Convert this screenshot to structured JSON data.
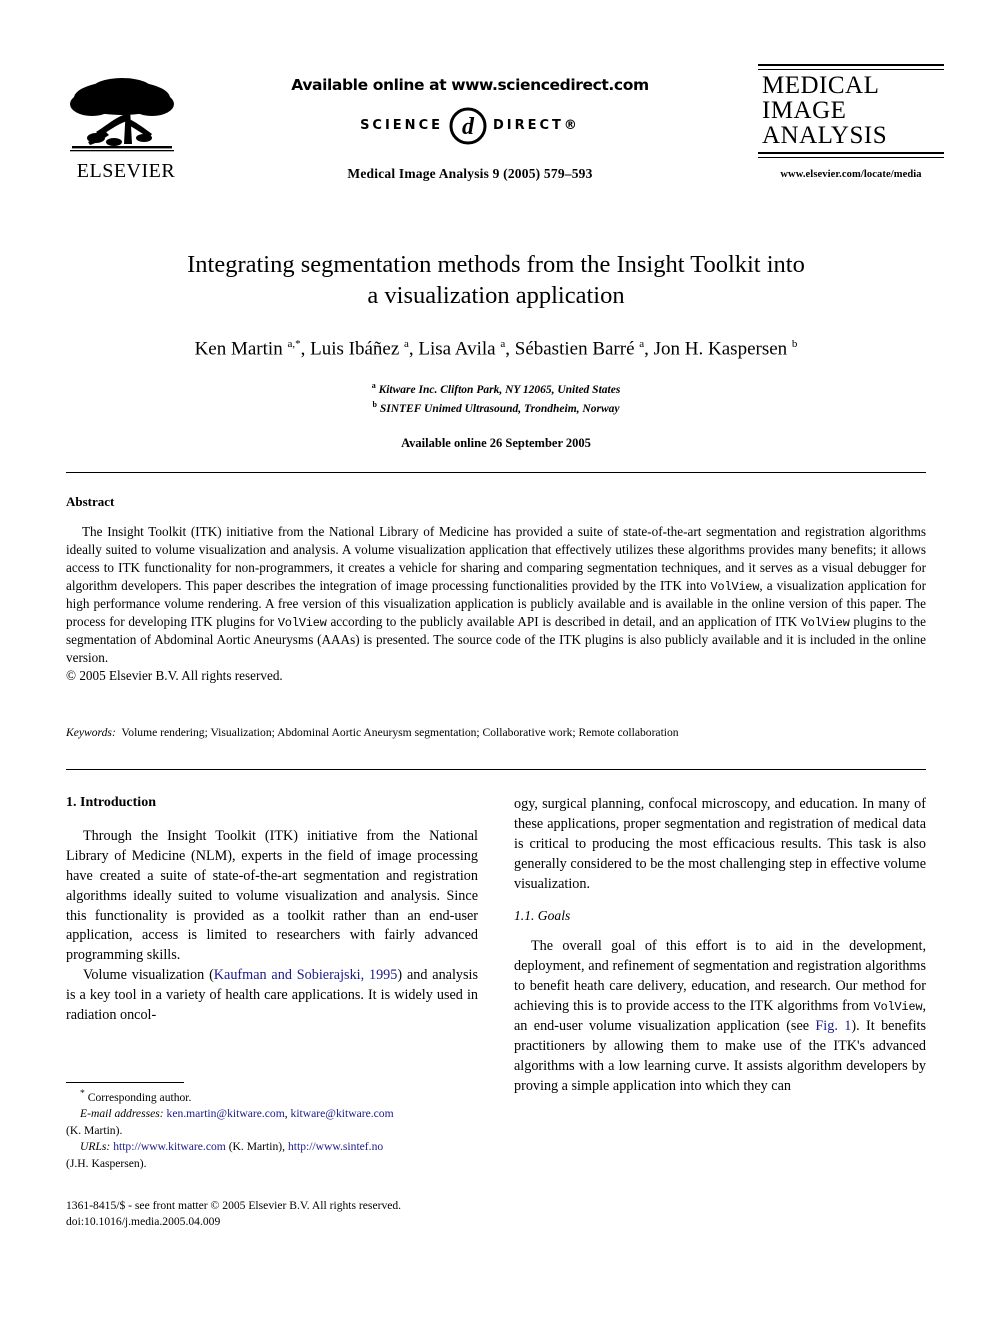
{
  "header": {
    "publisher_logo_name": "ELSEVIER",
    "available_online": "Available online at www.sciencedirect.com",
    "sciencedirect_left": "SCIENCE",
    "sciencedirect_right": "DIRECT®",
    "journal_citation": "Medical Image Analysis 9 (2005) 579–593",
    "journal_title_lines": [
      "MEDICAL",
      "IMAGE",
      "ANALYSIS"
    ],
    "journal_url": "www.elsevier.com/locate/media"
  },
  "title": {
    "line1": "Integrating segmentation methods from the Insight Toolkit into",
    "line2": "a visualization application"
  },
  "authors": {
    "list": "Ken Martin a,*, Luis Ibáñez a, Lisa Avila a, Sébastien Barré a, Jon H. Kaspersen b",
    "affiliation_a": "Kitware Inc. Clifton Park, NY 12065, United States",
    "affiliation_b": "SINTEF Unimed Ultrasound, Trondheim, Norway",
    "available_online_date": "Available online 26 September 2005"
  },
  "abstract": {
    "heading": "Abstract",
    "part1": "The Insight Toolkit (ITK) initiative from the National Library of Medicine has provided a suite of state-of-the-art segmentation and registration algorithms ideally suited to volume visualization and analysis. A volume visualization application that effectively utilizes these algorithms provides many benefits; it allows access to ITK functionality for non-programmers, it creates a vehicle for sharing and comparing segmentation techniques, and it serves as a visual debugger for algorithm developers. This paper describes the integration of image processing functionalities provided by the ITK into ",
    "mono1": "VolView",
    "part2": ", a visualization application for high performance volume rendering. A free version of this visualization application is publicly available and is available in the online version of this paper. The process for developing ITK plugins for ",
    "mono2": "VolView",
    "part3": " according to the publicly available API is described in detail, and an application of ITK ",
    "mono3": "VolView",
    "part4": " plugins to the segmentation of Abdominal Aortic Aneurysms (AAAs) is presented. The source code of the ITK plugins is also publicly available and it is included in the online version.",
    "copyright": "© 2005 Elsevier B.V. All rights reserved."
  },
  "keywords": {
    "label": "Keywords:",
    "value": "Volume rendering; Visualization; Abdominal Aortic Aneurysm segmentation; Collaborative work; Remote collaboration"
  },
  "body": {
    "section1_heading": "1. Introduction",
    "left_p1_a": "Through the Insight Toolkit (ITK) initiative from the National Library of Medicine (NLM), experts in the field of image processing have created a suite of state-of-the-art segmentation and registration algorithms ideally suited to volume visualization and analysis. Since this functionality is provided as a toolkit rather than an end-user application, access is limited to researchers with fairly advanced programming skills.",
    "left_p2_a": "Volume visualization (",
    "left_p2_link": "Kaufman and Sobierajski, 1995",
    "left_p2_b": ") and analysis is a key tool in a variety of health care applications. It is widely used in radiation oncol-",
    "right_p1": "ogy, surgical planning, confocal microscopy, and education. In many of these applications, proper segmentation and registration of medical data is critical to producing the most efficacious results. This task is also generally considered to be the most challenging step in effective volume visualization.",
    "subsection_heading": "1.1. Goals",
    "right_p2_a": "The overall goal of this effort is to aid in the development, deployment, and refinement of segmentation and registration algorithms to benefit heath care delivery, education, and research. Our method for achieving this is to provide access to the ITK algorithms from ",
    "right_p2_mono": "VolView",
    "right_p2_b": ", an end-user volume visualization application (see ",
    "right_p2_link": "Fig. 1",
    "right_p2_c": "). It benefits practitioners by allowing them to make use of the ITK's advanced algorithms with a low learning curve. It assists algorithm developers by proving a simple application into which they can"
  },
  "footnotes": {
    "corresponding": "Corresponding author.",
    "corresponding_marker": "*",
    "email_label": "E-mail addresses:",
    "email1": "ken.martin@kitware.com",
    "email_sep": ", ",
    "email2": "kitware@kitware.com",
    "email_attrib": "(K. Martin).",
    "urls_label": "URLs:",
    "url1": "http://www.kitware.com",
    "url1_attrib": "(K. Martin),",
    "url2": "http://www.sintef.no",
    "url2_attrib": "(J.H. Kaspersen)."
  },
  "imprint": {
    "line1": "1361-8415/$ - see front matter © 2005 Elsevier B.V. All rights reserved.",
    "line2": "doi:10.1016/j.media.2005.04.009"
  },
  "colors": {
    "text": "#000000",
    "link": "#1a1a8c",
    "page_background": "#ffffff"
  }
}
